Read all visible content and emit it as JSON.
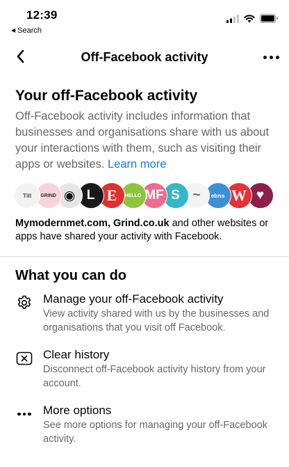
{
  "status_bar": {
    "time": "12:39",
    "back_app_label": "Search",
    "icons": [
      "cellular-signal-icon",
      "wifi-icon",
      "battery-icon"
    ]
  },
  "nav": {
    "title": "Off-Facebook activity",
    "back_icon": "chevron-left-icon",
    "more_icon": "more-horizontal-icon"
  },
  "summary": {
    "title": "Your off-Facebook activity",
    "description": "Off-Facebook activity includes information that businesses and organisations share with us about your interactions with them, such as visiting their apps or websites.",
    "learn_more": "Learn more",
    "shared_bold": "Mymodernmet.com, Grind.co.uk",
    "shared_rest": "and other websites or apps have shared your activity with Facebook."
  },
  "logos": [
    {
      "name": "modern-met",
      "bg": "#f2f2f2",
      "fg": "#555555",
      "text": "TIII",
      "sub": "MY MODERN MET"
    },
    {
      "name": "grind",
      "bg": "#f6d3dd",
      "fg": "#333333",
      "text": "GRIND"
    },
    {
      "name": "panda",
      "bg": "#e4e4e4",
      "fg": "#111111",
      "text": "◉"
    },
    {
      "name": "letter-l",
      "bg": "#1a1a1a",
      "fg": "#ffffff",
      "text": "L"
    },
    {
      "name": "letter-e",
      "bg": "#e0312f",
      "fg": "#ffffff",
      "text": "E"
    },
    {
      "name": "hello-fresh",
      "bg": "#8cc63f",
      "fg": "#ffffff",
      "text": "HELLO"
    },
    {
      "name": "mf",
      "bg": "#f06a8f",
      "fg": "#ffffff",
      "text": "MF"
    },
    {
      "name": "letter-s",
      "bg": "#35b6c9",
      "fg": "#ffffff",
      "text": "S"
    },
    {
      "name": "script-logo",
      "bg": "#f4f4f4",
      "fg": "#666666",
      "text": "~"
    },
    {
      "name": "blue-brand",
      "bg": "#3d8fd6",
      "fg": "#ffffff",
      "text": "ebns"
    },
    {
      "name": "letter-w",
      "bg": "#e53238",
      "fg": "#ffffff",
      "text": "W"
    },
    {
      "name": "heart-logo",
      "bg": "#8e1f4a",
      "fg": "#ffffff",
      "text": "♥"
    }
  ],
  "section": {
    "title": "What you can do"
  },
  "options": [
    {
      "title": "Manage your off-Facebook activity",
      "description": "View activity shared with us by the businesses and organisations that you visit off Facebook."
    },
    {
      "title": "Clear history",
      "description": "Disconnect off-Facebook activity history from your account."
    },
    {
      "title": "More options",
      "description": "See more options for managing your off-Facebook activity."
    }
  ]
}
